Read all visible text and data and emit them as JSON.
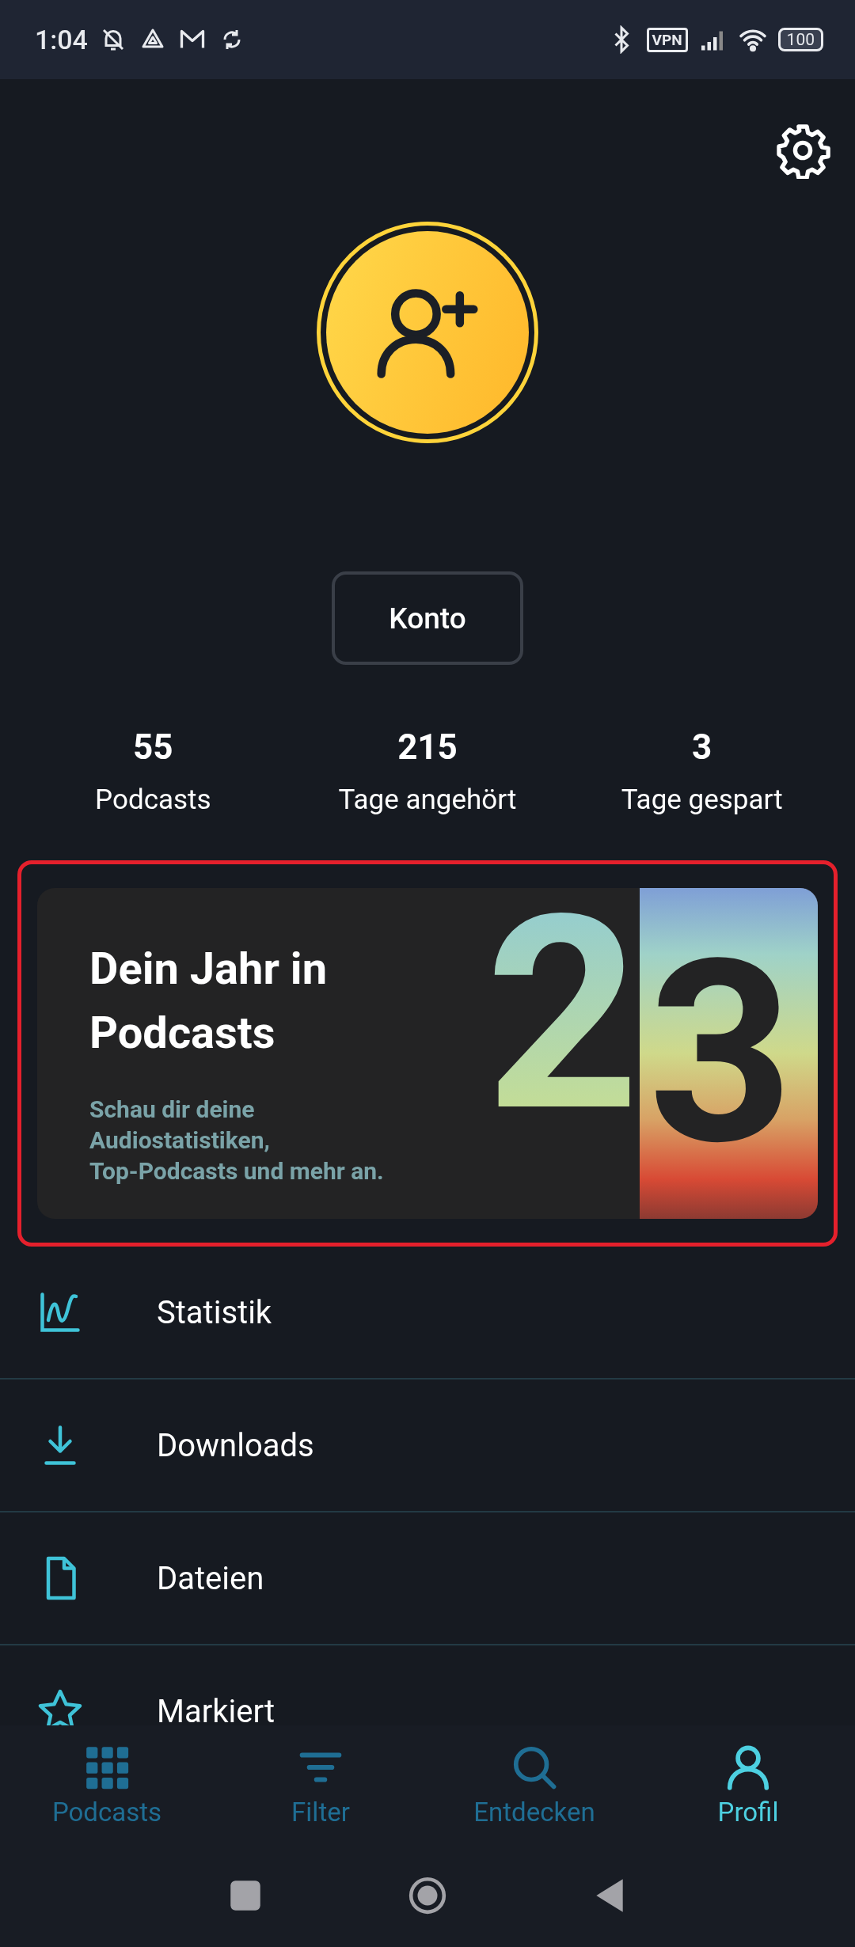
{
  "status_bar": {
    "time": "1:04",
    "vpn": "VPN",
    "battery": "100"
  },
  "account": {
    "button": "Konto"
  },
  "stats": [
    {
      "value": "55",
      "label": "Podcasts"
    },
    {
      "value": "215",
      "label": "Tage angehört"
    },
    {
      "value": "3",
      "label": "Tage gespart"
    }
  ],
  "banner": {
    "highlighted": true,
    "title": "Dein Jahr in Podcasts",
    "subtitle": "Schau dir deine\nAudiostatistiken,\nTop-Podcasts und mehr an.",
    "digits": [
      "2",
      "3"
    ]
  },
  "menu": [
    {
      "label": "Statistik"
    },
    {
      "label": "Downloads"
    },
    {
      "label": "Dateien"
    },
    {
      "label": "Markiert"
    }
  ],
  "nav": [
    {
      "label": "Podcasts",
      "selected": false
    },
    {
      "label": "Filter",
      "selected": false
    },
    {
      "label": "Entdecken",
      "selected": false
    },
    {
      "label": "Profil",
      "selected": true
    }
  ]
}
